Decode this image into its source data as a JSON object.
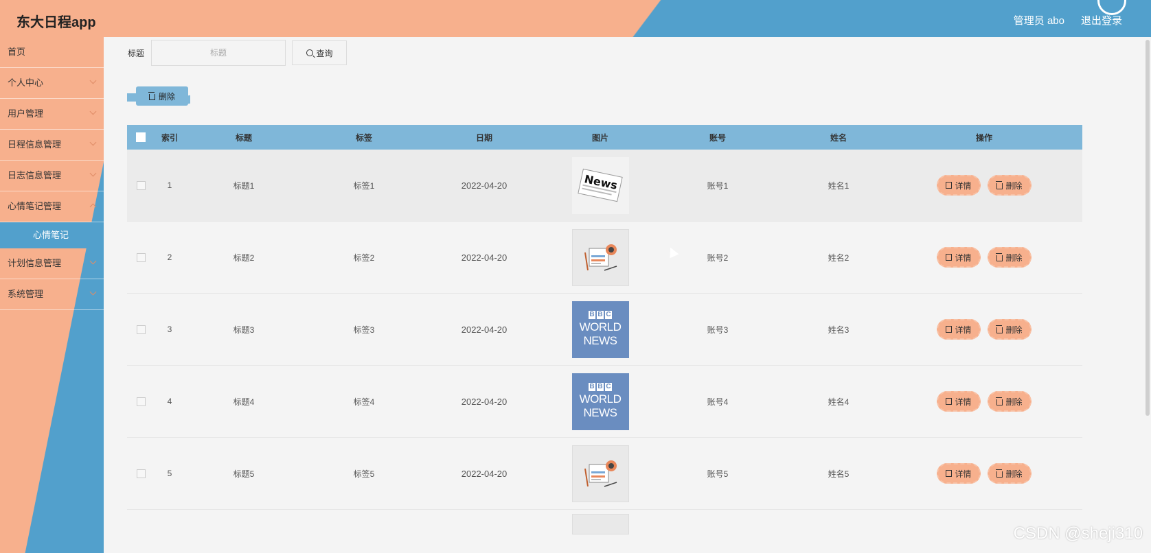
{
  "header": {
    "app_title": "东大日程app",
    "user_label": "管理员 abo",
    "logout_label": "退出登录"
  },
  "sidebar": {
    "items": [
      {
        "label": "首页"
      },
      {
        "label": "个人中心"
      },
      {
        "label": "用户管理"
      },
      {
        "label": "日程信息管理"
      },
      {
        "label": "日志信息管理"
      },
      {
        "label": "心情笔记管理"
      },
      {
        "label": "计划信息管理"
      },
      {
        "label": "系统管理"
      }
    ],
    "active_sub": "心情笔记"
  },
  "search": {
    "label": "标题",
    "placeholder": "标题",
    "button_label": "查询"
  },
  "bulk_delete_label": "删除",
  "table": {
    "headers": [
      "索引",
      "标题",
      "标签",
      "日期",
      "图片",
      "账号",
      "姓名",
      "操作"
    ],
    "rows": [
      {
        "index": "1",
        "title": "标题1",
        "tag": "标签1",
        "date": "2022-04-20",
        "image": "news-paper",
        "account": "账号1",
        "name": "姓名1"
      },
      {
        "index": "2",
        "title": "标题2",
        "tag": "标签2",
        "date": "2022-04-20",
        "image": "news-desk",
        "account": "账号2",
        "name": "姓名2"
      },
      {
        "index": "3",
        "title": "标题3",
        "tag": "标签3",
        "date": "2022-04-20",
        "image": "bbc-world-news",
        "account": "账号3",
        "name": "姓名3"
      },
      {
        "index": "4",
        "title": "标题4",
        "tag": "标签4",
        "date": "2022-04-20",
        "image": "bbc-world-news",
        "account": "账号4",
        "name": "姓名4"
      },
      {
        "index": "5",
        "title": "标题5",
        "tag": "标签5",
        "date": "2022-04-20",
        "image": "news-desk",
        "account": "账号5",
        "name": "姓名5"
      }
    ],
    "detail_label": "详情",
    "delete_label": "删除"
  },
  "bbc": {
    "letters": [
      "B",
      "B",
      "C"
    ],
    "line1": "WORLD",
    "line2": "NEWS"
  },
  "news_word": "News",
  "watermark": "CSDN @sheji310",
  "colors": {
    "peach": "#f7b08d",
    "blue": "#52a0cc",
    "table_header": "#7fb7d9"
  }
}
